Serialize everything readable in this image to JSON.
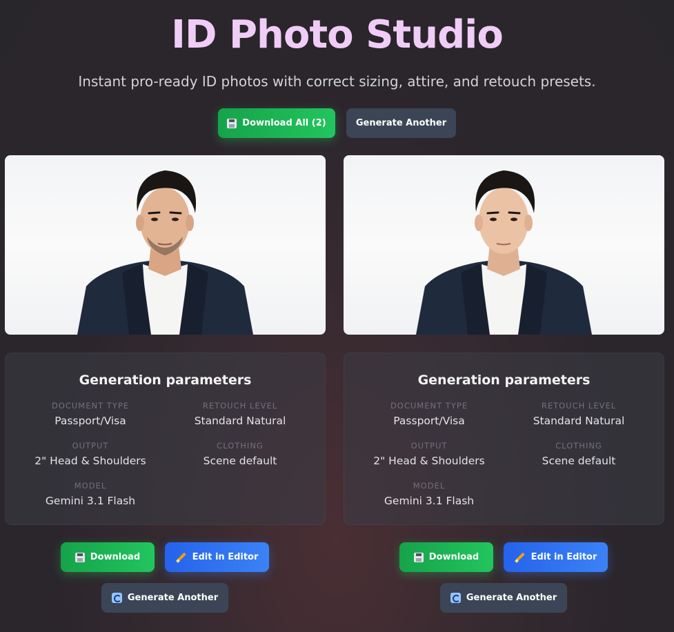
{
  "header": {
    "title": "ID Photo Studio",
    "subtitle": "Instant pro-ready ID photos with correct sizing, attire, and retouch presets."
  },
  "top_actions": {
    "download_all_label": "Download All (2)",
    "generate_another_label": "Generate Another"
  },
  "results": [
    {
      "params_title": "Generation parameters",
      "document_type_label": "DOCUMENT TYPE",
      "document_type": "Passport/Visa",
      "retouch_level_label": "RETOUCH LEVEL",
      "retouch_level": "Standard Natural",
      "output_label": "OUTPUT",
      "output": "2\" Head & Shoulders",
      "clothing_label": "CLOTHING",
      "clothing": "Scene default",
      "model_label": "MODEL",
      "model": "Gemini 3.1 Flash",
      "download_label": "Download",
      "edit_label": "Edit in Editor",
      "generate_another_label": "Generate Another"
    },
    {
      "params_title": "Generation parameters",
      "document_type_label": "DOCUMENT TYPE",
      "document_type": "Passport/Visa",
      "retouch_level_label": "RETOUCH LEVEL",
      "retouch_level": "Standard Natural",
      "output_label": "OUTPUT",
      "output": "2\" Head & Shoulders",
      "clothing_label": "CLOTHING",
      "clothing": "Scene default",
      "model_label": "MODEL",
      "model": "Gemini 3.1 Flash",
      "download_label": "Download",
      "edit_label": "Edit in Editor",
      "generate_another_label": "Generate Another"
    }
  ],
  "colors": {
    "title": "#f0cdf7",
    "accent_green": "#22c55e",
    "accent_blue": "#3b82f6",
    "button_slate": "#3b4556"
  },
  "icons": {
    "download": "floppy-disk-icon",
    "edit": "pencil-icon",
    "regenerate": "refresh-icon"
  }
}
